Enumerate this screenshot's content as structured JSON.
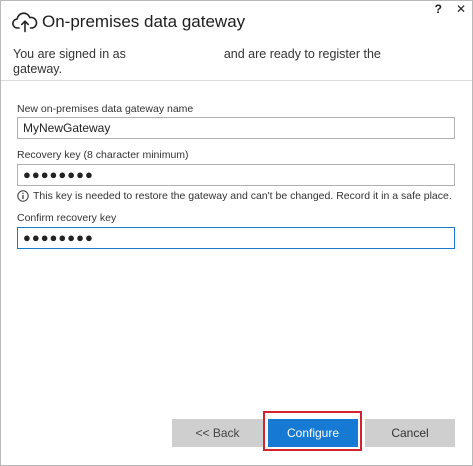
{
  "window": {
    "help": "?",
    "close": "✕"
  },
  "header": {
    "title": "On-premises data gateway",
    "subtitle_part1": "You are signed in as",
    "subtitle_part2": "and are ready to register the",
    "subtitle_part3": "gateway."
  },
  "form": {
    "name_label": "New on-premises data gateway name",
    "name_value": "MyNewGateway",
    "recovery_label": "Recovery key (8 character minimum)",
    "recovery_value": "●●●●●●●●",
    "info_text": "This key is needed to restore the gateway and can't be changed. Record it in a safe place.",
    "confirm_label": "Confirm recovery key",
    "confirm_value": "●●●●●●●●"
  },
  "buttons": {
    "back": "<< Back",
    "configure": "Configure",
    "cancel": "Cancel"
  },
  "colors": {
    "accent": "#1679d4",
    "highlight": "#d4232e"
  }
}
